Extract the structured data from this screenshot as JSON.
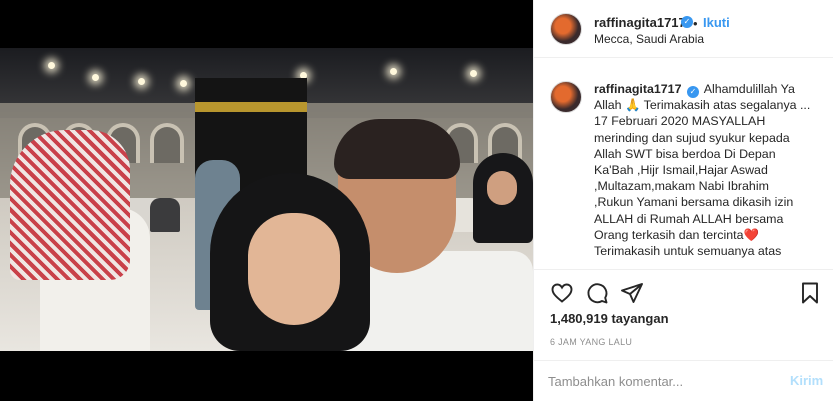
{
  "post": {
    "header": {
      "username": "raffinagita1717",
      "verified_icon": "verified-badge-icon",
      "separator": "•",
      "follow_label": "Ikuti",
      "location": "Mecca, Saudi Arabia",
      "more_icon": "more-options-icon"
    },
    "caption": {
      "username": "raffinagita1717",
      "lines": [
        "Alhamdulillah Ya",
        "Allah 🙏 Terimakasih atas segalanya ...",
        "17 Februari 2020 MASYALLAH",
        "merinding dan sujud syukur kepada",
        "Allah SWT bisa berdoa Di Depan",
        "Ka'Bah ,Hijr Ismail,Hajar Aswad",
        ",Multazam,makam Nabi Ibrahim",
        ",Rukun Yamani bersama dikasih izin",
        "ALLAH di Rumah ALLAH bersama",
        "Orang terkasih dan tercinta❤️",
        "Terimakasih untuk semuanya atas"
      ]
    },
    "actions": {
      "like_icon": "heart-icon",
      "comment_icon": "comment-icon",
      "share_icon": "share-icon",
      "save_icon": "bookmark-icon"
    },
    "views_text": "1,480,919 tayangan",
    "time_text": "6 JAM YANG LALU",
    "comment": {
      "placeholder": "Tambahkan komentar...",
      "post_label": "Kirim"
    },
    "colors": {
      "link_blue": "#3897f0",
      "post_disabled": "#b2dffc",
      "border": "#efefef",
      "muted": "#8e8e8e"
    }
  }
}
